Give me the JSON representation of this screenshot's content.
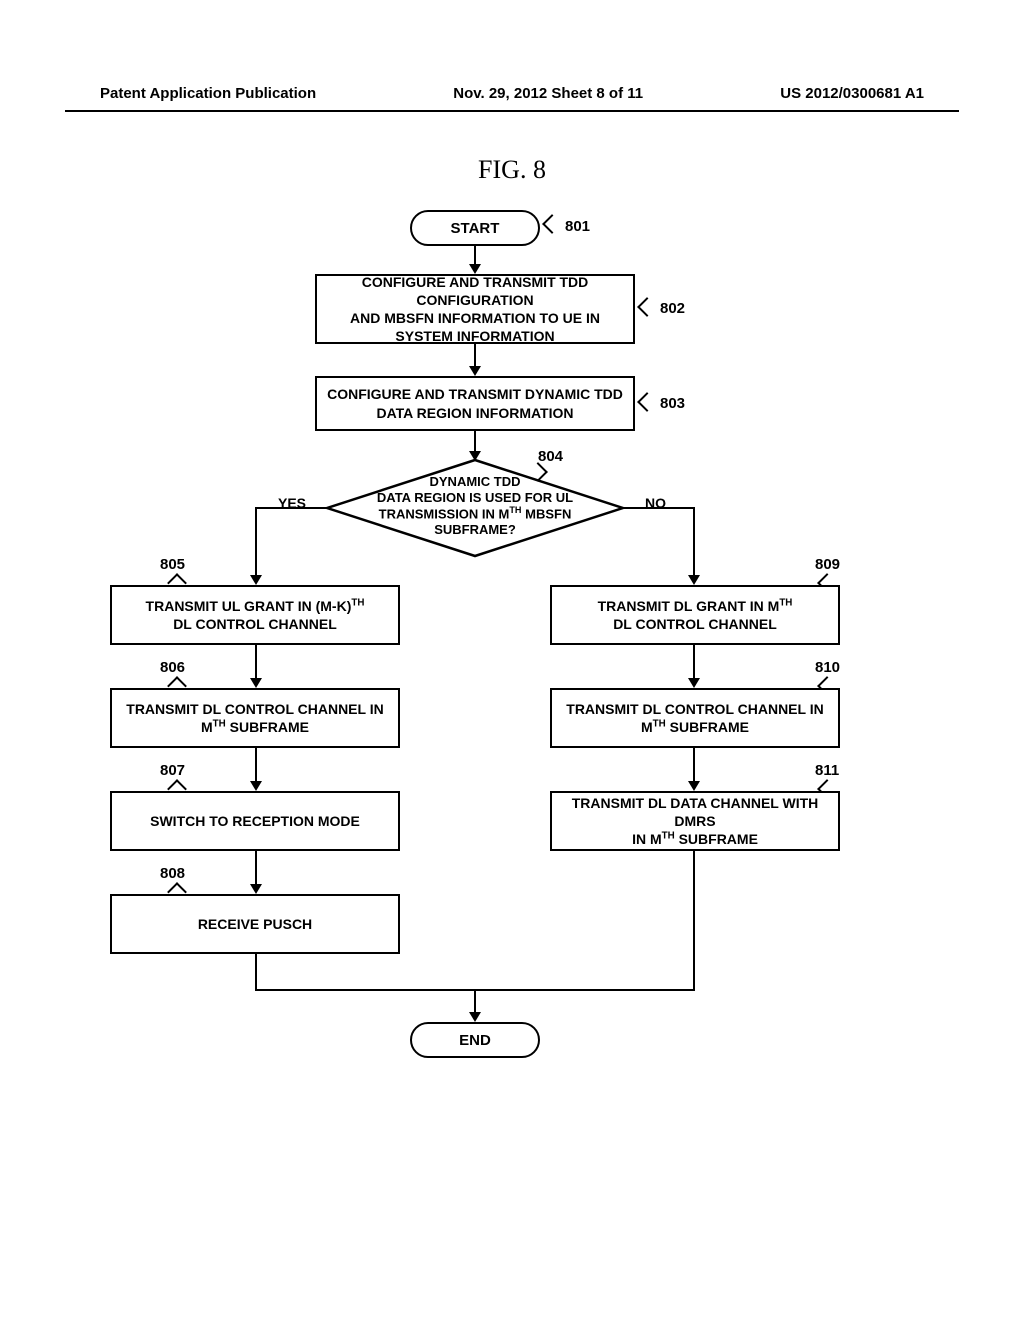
{
  "header": {
    "left": "Patent Application Publication",
    "center": "Nov. 29, 2012  Sheet 8 of 11",
    "right": "US 2012/0300681 A1"
  },
  "figure_title": "FIG. 8",
  "nodes": {
    "start": "START",
    "end": "END",
    "step802_line1": "CONFIGURE AND TRANSMIT TDD CONFIGURATION",
    "step802_line2": "AND MBSFN INFORMATION TO UE IN",
    "step802_line3": "SYSTEM INFORMATION",
    "step803_line1": "CONFIGURE AND TRANSMIT DYNAMIC TDD",
    "step803_line2": "DATA REGION INFORMATION",
    "decision_line1": "DYNAMIC TDD",
    "decision_line2": "DATA REGION IS USED FOR UL",
    "decision_line3": "TRANSMISSION IN M",
    "decision_line3_suffix": " MBSFN",
    "decision_line4": "SUBFRAME?",
    "step805_line1": "TRANSMIT UL GRANT IN (M-K)",
    "step805_line2": "DL CONTROL CHANNEL",
    "step806_line1": "TRANSMIT DL CONTROL CHANNEL IN",
    "step806_line2": "M",
    "step806_line2_suffix": " SUBFRAME",
    "step807": "SWITCH TO RECEPTION MODE",
    "step808": "RECEIVE PUSCH",
    "step809_line1": "TRANSMIT DL GRANT IN M",
    "step809_line2": "DL CONTROL CHANNEL",
    "step810_line1": "TRANSMIT DL CONTROL CHANNEL IN",
    "step810_line2": "M",
    "step810_line2_suffix": " SUBFRAME",
    "step811_line1": "TRANSMIT DL DATA CHANNEL WITH DMRS",
    "step811_line2": "IN M",
    "step811_line2_suffix": " SUBFRAME"
  },
  "labels": {
    "ref801": "801",
    "ref802": "802",
    "ref803": "803",
    "ref804": "804",
    "ref805": "805",
    "ref806": "806",
    "ref807": "807",
    "ref808": "808",
    "ref809": "809",
    "ref810": "810",
    "ref811": "811",
    "yes": "YES",
    "no": "NO",
    "th": "TH"
  },
  "chart_data": {
    "type": "flowchart",
    "title": "FIG. 8",
    "nodes": [
      {
        "id": "801",
        "type": "terminal",
        "label": "START"
      },
      {
        "id": "802",
        "type": "process",
        "label": "CONFIGURE AND TRANSMIT TDD CONFIGURATION AND MBSFN INFORMATION TO UE IN SYSTEM INFORMATION"
      },
      {
        "id": "803",
        "type": "process",
        "label": "CONFIGURE AND TRANSMIT DYNAMIC TDD DATA REGION INFORMATION"
      },
      {
        "id": "804",
        "type": "decision",
        "label": "DYNAMIC TDD DATA REGION IS USED FOR UL TRANSMISSION IN M-TH MBSFN SUBFRAME?"
      },
      {
        "id": "805",
        "type": "process",
        "label": "TRANSMIT UL GRANT IN (M-K)-TH DL CONTROL CHANNEL"
      },
      {
        "id": "806",
        "type": "process",
        "label": "TRANSMIT DL CONTROL CHANNEL IN M-TH SUBFRAME"
      },
      {
        "id": "807",
        "type": "process",
        "label": "SWITCH TO RECEPTION MODE"
      },
      {
        "id": "808",
        "type": "process",
        "label": "RECEIVE PUSCH"
      },
      {
        "id": "809",
        "type": "process",
        "label": "TRANSMIT DL GRANT IN M-TH DL CONTROL CHANNEL"
      },
      {
        "id": "810",
        "type": "process",
        "label": "TRANSMIT DL CONTROL CHANNEL IN M-TH SUBFRAME"
      },
      {
        "id": "811",
        "type": "process",
        "label": "TRANSMIT DL DATA CHANNEL WITH DMRS IN M-TH SUBFRAME"
      },
      {
        "id": "end",
        "type": "terminal",
        "label": "END"
      }
    ],
    "edges": [
      {
        "from": "801",
        "to": "802"
      },
      {
        "from": "802",
        "to": "803"
      },
      {
        "from": "803",
        "to": "804"
      },
      {
        "from": "804",
        "to": "805",
        "label": "YES"
      },
      {
        "from": "804",
        "to": "809",
        "label": "NO"
      },
      {
        "from": "805",
        "to": "806"
      },
      {
        "from": "806",
        "to": "807"
      },
      {
        "from": "807",
        "to": "808"
      },
      {
        "from": "809",
        "to": "810"
      },
      {
        "from": "810",
        "to": "811"
      },
      {
        "from": "808",
        "to": "end"
      },
      {
        "from": "811",
        "to": "end"
      }
    ]
  }
}
